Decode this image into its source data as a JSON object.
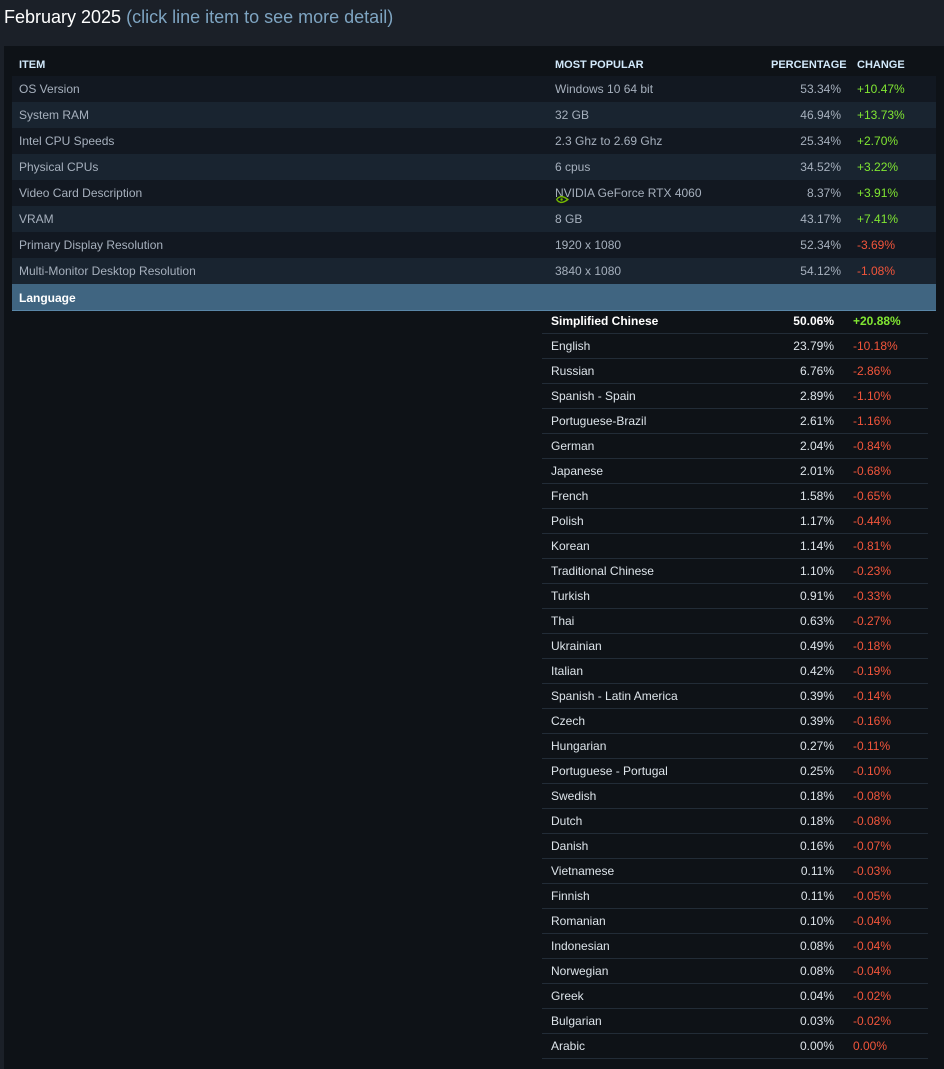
{
  "header": {
    "title": "February 2025",
    "subtitle": "(click line item to see more detail)"
  },
  "table": {
    "columns": {
      "item": "ITEM",
      "most_popular": "MOST POPULAR",
      "percentage": "PERCENTAGE",
      "change": "CHANGE"
    },
    "rows": [
      {
        "item": "OS Version",
        "most_popular": "Windows 10 64 bit",
        "percentage": "53.34%",
        "change": "+10.47%"
      },
      {
        "item": "System RAM",
        "most_popular": "32 GB",
        "percentage": "46.94%",
        "change": "+13.73%"
      },
      {
        "item": "Intel CPU Speeds",
        "most_popular": "2.3 Ghz to 2.69 Ghz",
        "percentage": "25.34%",
        "change": "+2.70%"
      },
      {
        "item": "Physical CPUs",
        "most_popular": "6 cpus",
        "percentage": "34.52%",
        "change": "+3.22%"
      },
      {
        "item": "Video Card Description",
        "most_popular": "NVIDIA GeForce RTX 4060",
        "percentage": "8.37%",
        "change": "+3.91%",
        "icon": "nvidia-logo-icon"
      },
      {
        "item": "VRAM",
        "most_popular": "8 GB",
        "percentage": "43.17%",
        "change": "+7.41%"
      },
      {
        "item": "Primary Display Resolution",
        "most_popular": "1920 x 1080",
        "percentage": "52.34%",
        "change": "-3.69%"
      },
      {
        "item": "Multi-Monitor Desktop Resolution",
        "most_popular": "3840 x 1080",
        "percentage": "54.12%",
        "change": "-1.08%"
      }
    ]
  },
  "language": {
    "label": "Language",
    "rows": [
      {
        "name": "Simplified Chinese",
        "percentage": "50.06%",
        "change": "+20.88%"
      },
      {
        "name": "English",
        "percentage": "23.79%",
        "change": "-10.18%"
      },
      {
        "name": "Russian",
        "percentage": "6.76%",
        "change": "-2.86%"
      },
      {
        "name": "Spanish - Spain",
        "percentage": "2.89%",
        "change": "-1.10%"
      },
      {
        "name": "Portuguese-Brazil",
        "percentage": "2.61%",
        "change": "-1.16%"
      },
      {
        "name": "German",
        "percentage": "2.04%",
        "change": "-0.84%"
      },
      {
        "name": "Japanese",
        "percentage": "2.01%",
        "change": "-0.68%"
      },
      {
        "name": "French",
        "percentage": "1.58%",
        "change": "-0.65%"
      },
      {
        "name": "Polish",
        "percentage": "1.17%",
        "change": "-0.44%"
      },
      {
        "name": "Korean",
        "percentage": "1.14%",
        "change": "-0.81%"
      },
      {
        "name": "Traditional Chinese",
        "percentage": "1.10%",
        "change": "-0.23%"
      },
      {
        "name": "Turkish",
        "percentage": "0.91%",
        "change": "-0.33%"
      },
      {
        "name": "Thai",
        "percentage": "0.63%",
        "change": "-0.27%"
      },
      {
        "name": "Ukrainian",
        "percentage": "0.49%",
        "change": "-0.18%"
      },
      {
        "name": "Italian",
        "percentage": "0.42%",
        "change": "-0.19%"
      },
      {
        "name": "Spanish - Latin America",
        "percentage": "0.39%",
        "change": "-0.14%"
      },
      {
        "name": "Czech",
        "percentage": "0.39%",
        "change": "-0.16%"
      },
      {
        "name": "Hungarian",
        "percentage": "0.27%",
        "change": "-0.11%"
      },
      {
        "name": "Portuguese - Portugal",
        "percentage": "0.25%",
        "change": "-0.10%"
      },
      {
        "name": "Swedish",
        "percentage": "0.18%",
        "change": "-0.08%"
      },
      {
        "name": "Dutch",
        "percentage": "0.18%",
        "change": "-0.08%"
      },
      {
        "name": "Danish",
        "percentage": "0.16%",
        "change": "-0.07%"
      },
      {
        "name": "Vietnamese",
        "percentage": "0.11%",
        "change": "-0.03%"
      },
      {
        "name": "Finnish",
        "percentage": "0.11%",
        "change": "-0.05%"
      },
      {
        "name": "Romanian",
        "percentage": "0.10%",
        "change": "-0.04%"
      },
      {
        "name": "Indonesian",
        "percentage": "0.08%",
        "change": "-0.04%"
      },
      {
        "name": "Norwegian",
        "percentage": "0.08%",
        "change": "-0.04%"
      },
      {
        "name": "Greek",
        "percentage": "0.04%",
        "change": "-0.02%"
      },
      {
        "name": "Bulgarian",
        "percentage": "0.03%",
        "change": "-0.02%"
      },
      {
        "name": "Arabic",
        "percentage": "0.00%",
        "change": "0.00%"
      }
    ]
  },
  "colors": {
    "positive": "#80e632",
    "negative": "#f2553b",
    "highlight_row": "#406581"
  }
}
